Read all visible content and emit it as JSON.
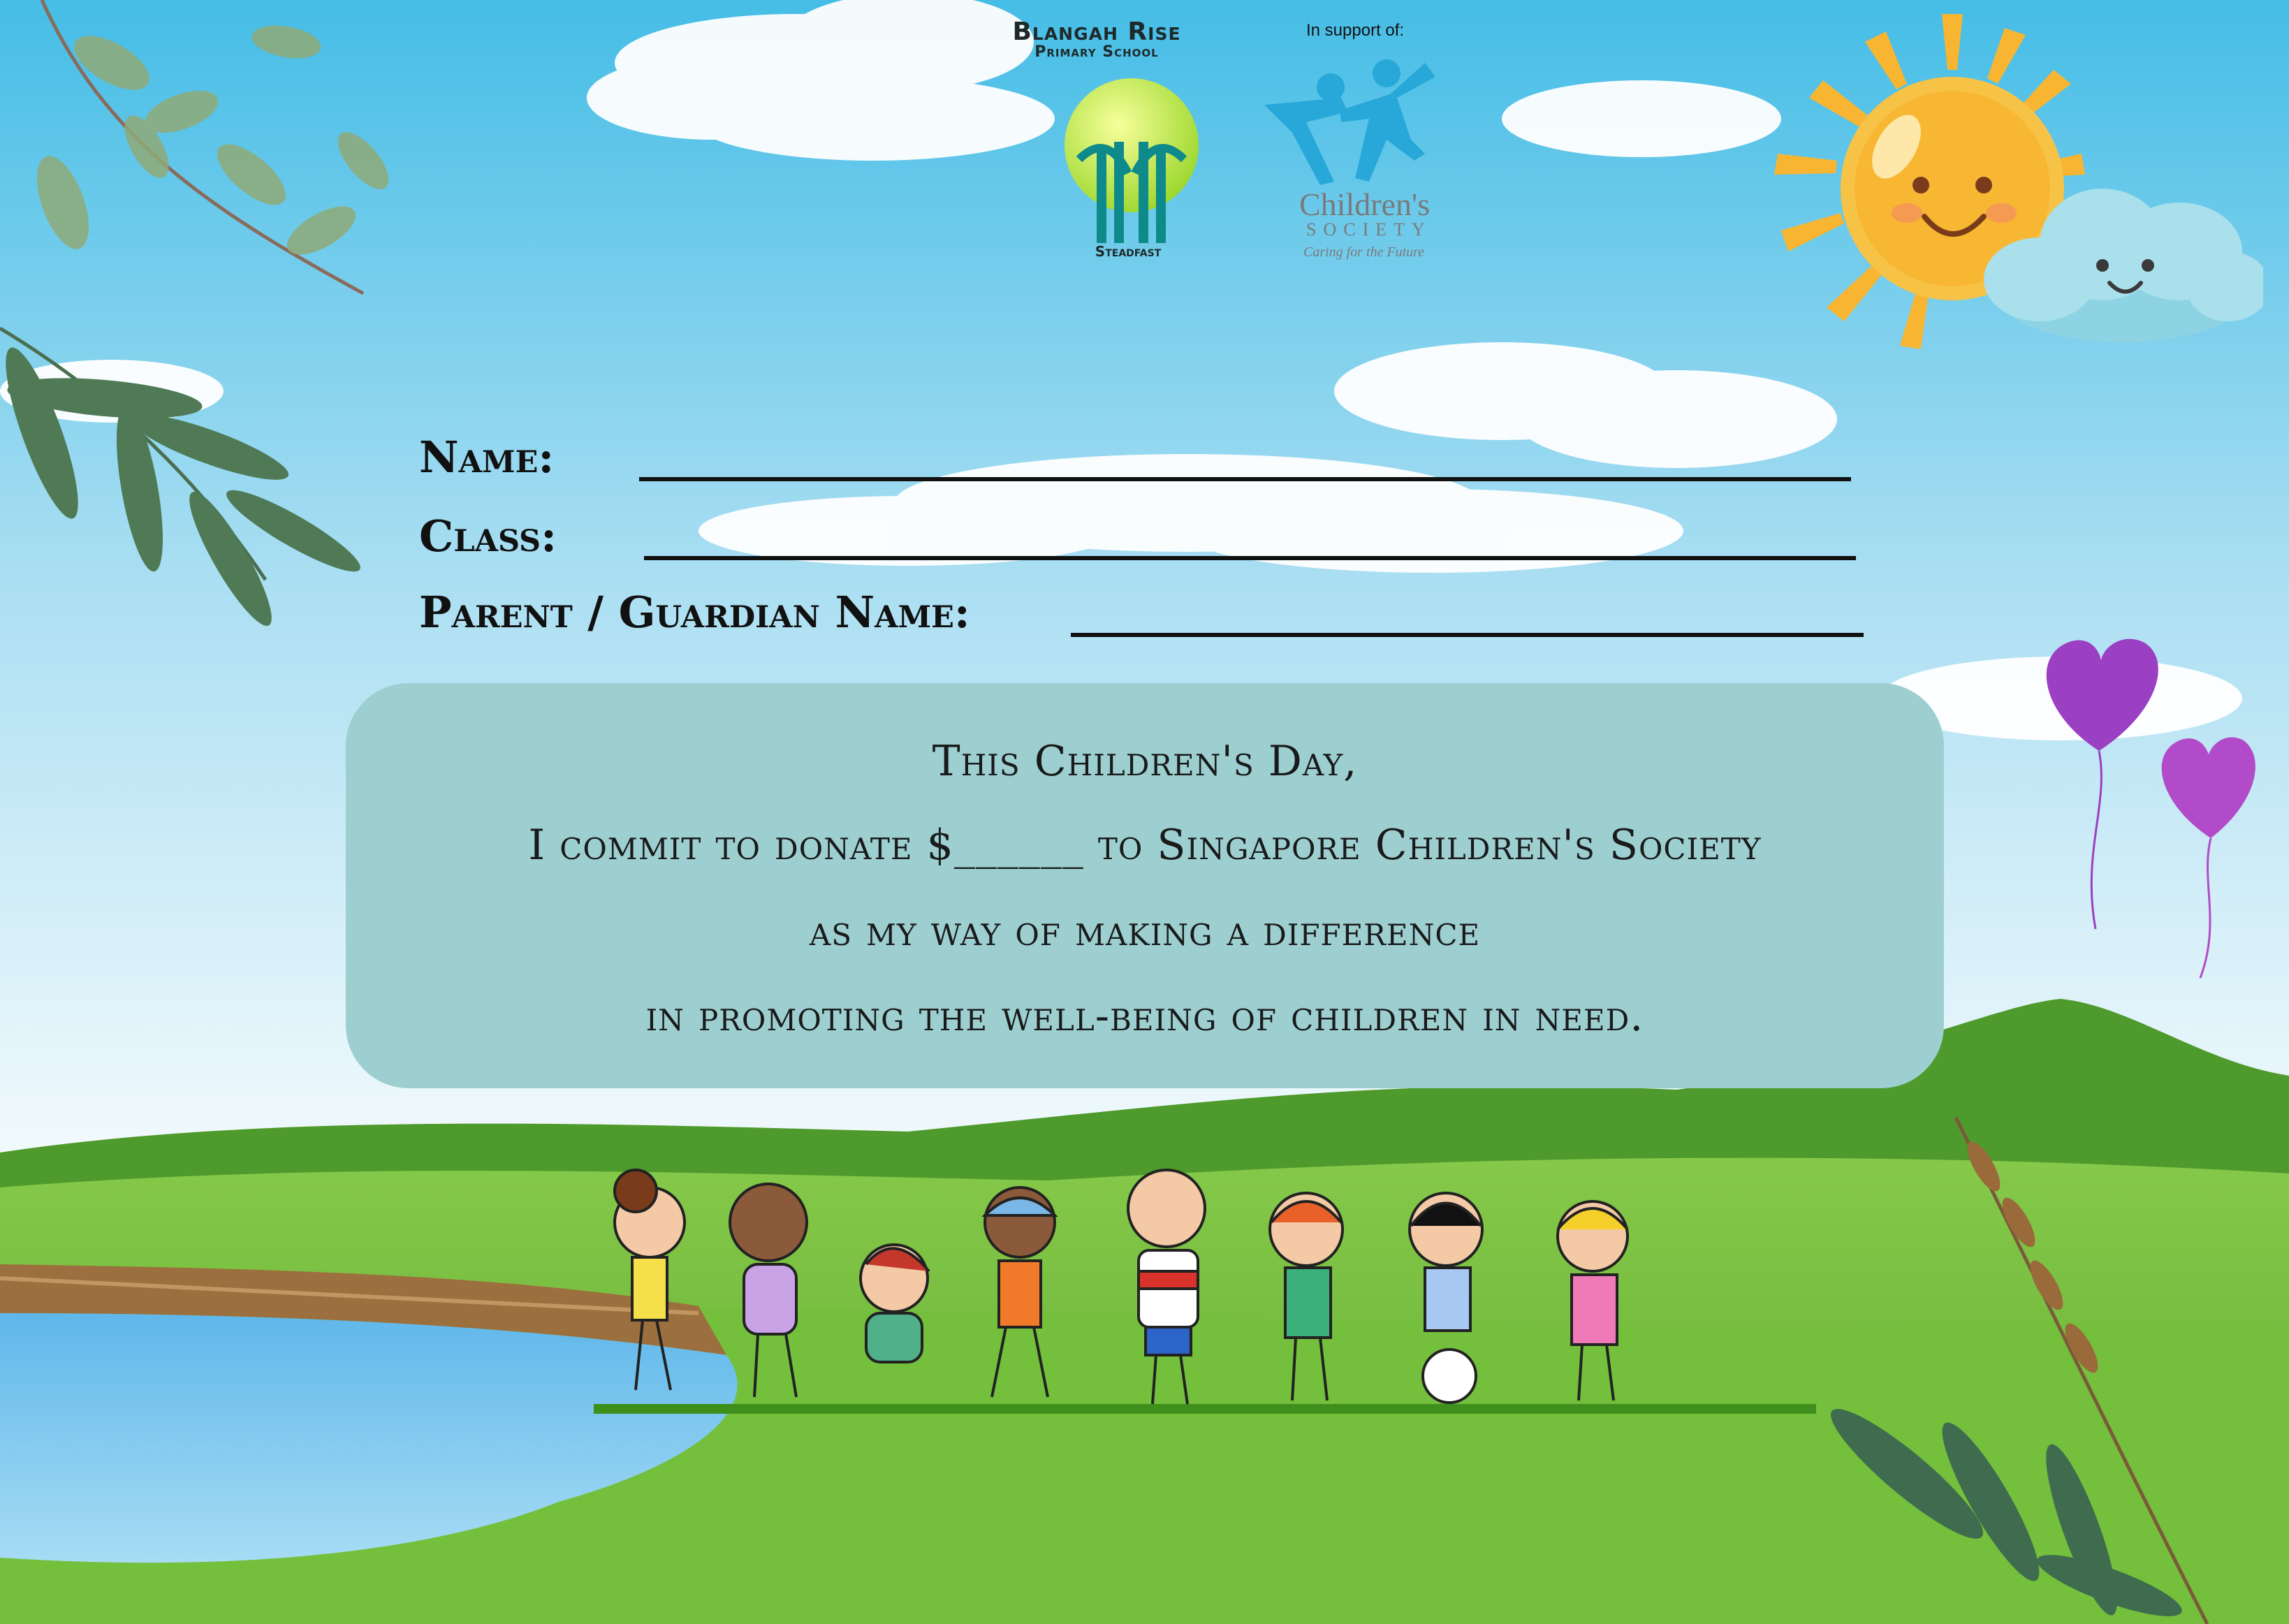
{
  "header": {
    "school_line1": "Blangah Rise",
    "school_line2": "Primary School",
    "school_motto": "Steadfast",
    "support_label": "In support of:",
    "partner_name": "Children's",
    "partner_society": "SOCIETY",
    "partner_tagline": "Caring for the Future"
  },
  "form": {
    "name_label": "Name:",
    "class_label": "Class:",
    "guardian_label": "Parent / Guardian Name:"
  },
  "pledge": {
    "line1": "This Children's Day,",
    "line2": "I commit to donate $______ to Singapore Children's Society",
    "line3": "as my way of making a difference",
    "line4": "in promoting the well-being of children in need."
  },
  "colors": {
    "sky_top": "#49c0e6",
    "sky_bottom": "#eaf7fb",
    "pledge_box": "#9dcfd1",
    "grass": "#6cb83a",
    "lake": "#74c6ee",
    "sun": "#f7b532",
    "balloon": "#9b3fc3"
  },
  "icons": [
    "school-crest-icon",
    "childrens-society-logo-icon",
    "sun-icon",
    "smiling-cloud-icon",
    "heart-balloon-icon",
    "leaf-branch-icon",
    "kids-illustration"
  ]
}
